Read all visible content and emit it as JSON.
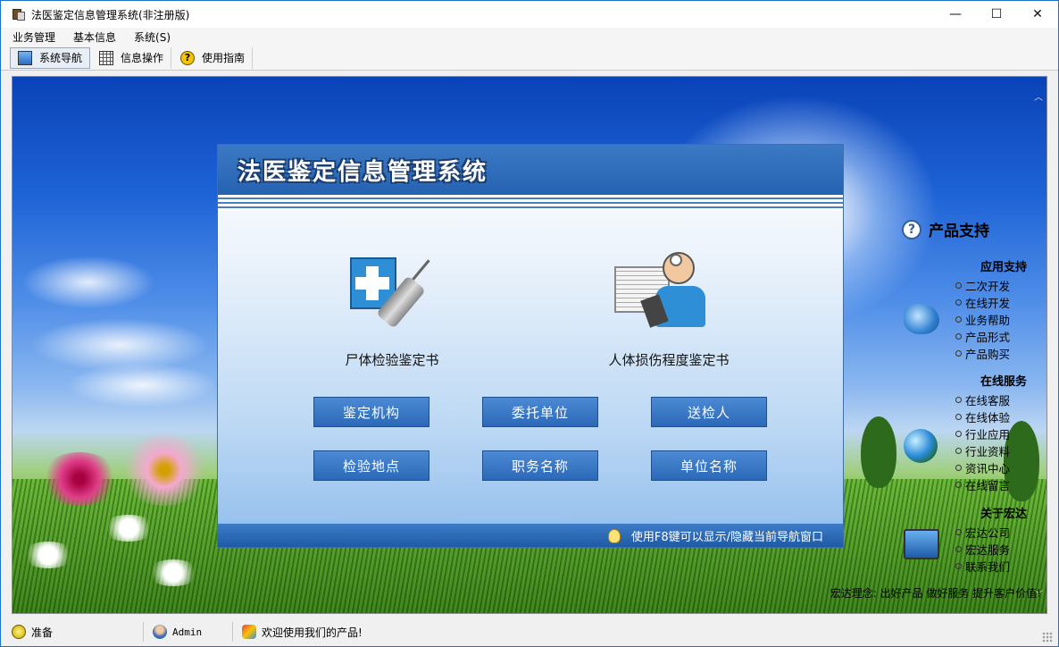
{
  "window": {
    "title": "法医鉴定信息管理系统(非注册版)",
    "controls": {
      "minimize": "—",
      "maximize": "☐",
      "close": "✕"
    }
  },
  "menu": [
    "业务管理",
    "基本信息",
    "系统(S)"
  ],
  "toolbar": [
    {
      "label": "系统导航",
      "icon": "monitor-icon"
    },
    {
      "label": "信息操作",
      "icon": "grid-icon"
    },
    {
      "label": "使用指南",
      "icon": "help-icon"
    }
  ],
  "panel": {
    "title": "法医鉴定信息管理系统",
    "features": [
      {
        "label": "尸体检验鉴定书",
        "icon": "medical-kit-syringe-icon"
      },
      {
        "label": "人体损伤程度鉴定书",
        "icon": "doctor-icon"
      }
    ],
    "buttons": [
      [
        "鉴定机构",
        "委托单位",
        "送检人"
      ],
      [
        "检验地点",
        "职务名称",
        "单位名称"
      ]
    ],
    "hint": "使用F8键可以显示/隐藏当前导航窗口"
  },
  "sidebar": {
    "heading": "产品支持",
    "sections": [
      {
        "title": "应用支持",
        "items": [
          "二次开发",
          "在线开发",
          "业务帮助",
          "产品形式",
          "产品购买"
        ]
      },
      {
        "title": "在线服务",
        "items": [
          "在线客服",
          "在线体验",
          "行业应用",
          "行业资料",
          "资讯中心",
          "在线留言"
        ]
      },
      {
        "title": "关于宏达",
        "items": [
          "宏达公司",
          "宏达服务",
          "联系我们"
        ]
      }
    ],
    "slogan": "宏达理念: 出好产品 做好服务 提升客户价值!"
  },
  "status": {
    "state": "准备",
    "user": "Admin",
    "message": "欢迎使用我们的产品!"
  },
  "colors": {
    "accent": "#2b68b8",
    "titlebar_border": "#1a73c8"
  }
}
